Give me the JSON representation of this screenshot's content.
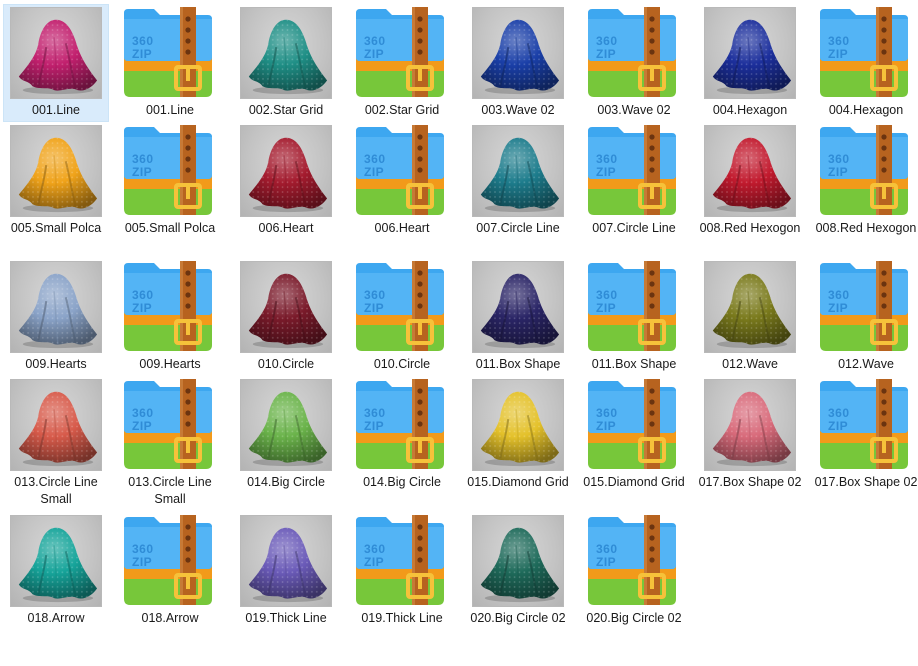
{
  "files": [
    {
      "label": "001.Line",
      "kind": "image",
      "color": "#c2206e",
      "selected": true
    },
    {
      "label": "001.Line",
      "kind": "zip",
      "icon": "360zip-archive-icon"
    },
    {
      "label": "002.Star Grid",
      "kind": "image",
      "color": "#1f8f86"
    },
    {
      "label": "002.Star Grid",
      "kind": "zip",
      "icon": "360zip-archive-icon"
    },
    {
      "label": "003.Wave 02",
      "kind": "image",
      "color": "#1a3fa8"
    },
    {
      "label": "003.Wave 02",
      "kind": "zip",
      "icon": "360zip-archive-icon"
    },
    {
      "label": "004.Hexagon",
      "kind": "image",
      "color": "#1c2f9c"
    },
    {
      "label": "004.Hexagon",
      "kind": "zip",
      "icon": "360zip-archive-icon"
    },
    {
      "label": "005.Small Polca",
      "kind": "image",
      "color": "#f0a31a"
    },
    {
      "label": "005.Small Polca",
      "kind": "zip",
      "icon": "360zip-archive-icon"
    },
    {
      "label": "006.Heart",
      "kind": "image",
      "color": "#a41b2e"
    },
    {
      "label": "006.Heart",
      "kind": "zip",
      "icon": "360zip-archive-icon"
    },
    {
      "label": "007.Circle Line",
      "kind": "image",
      "color": "#1d7c8c"
    },
    {
      "label": "007.Circle Line",
      "kind": "zip",
      "icon": "360zip-archive-icon"
    },
    {
      "label": "008.Red Hexogon",
      "kind": "image",
      "color": "#c21a2e"
    },
    {
      "label": "008.Red Hexogon",
      "kind": "zip",
      "icon": "360zip-archive-icon"
    },
    {
      "label": "009.Hearts",
      "kind": "image",
      "color": "#8aa3c8"
    },
    {
      "label": "009.Hearts",
      "kind": "zip",
      "icon": "360zip-archive-icon"
    },
    {
      "label": "010.Circle",
      "kind": "image",
      "color": "#7a1a2a"
    },
    {
      "label": "010.Circle",
      "kind": "zip",
      "icon": "360zip-archive-icon"
    },
    {
      "label": "011.Box Shape",
      "kind": "image",
      "color": "#2a2566"
    },
    {
      "label": "011.Box Shape",
      "kind": "zip",
      "icon": "360zip-archive-icon"
    },
    {
      "label": "012.Wave",
      "kind": "image",
      "color": "#7a7a1c"
    },
    {
      "label": "012.Wave",
      "kind": "zip",
      "icon": "360zip-archive-icon"
    },
    {
      "label": "013.Circle Line Small",
      "kind": "image",
      "color": "#d75a4a"
    },
    {
      "label": "013.Circle Line Small",
      "kind": "zip",
      "icon": "360zip-archive-icon"
    },
    {
      "label": "014.Big Circle",
      "kind": "image",
      "color": "#6ab34a"
    },
    {
      "label": "014.Big Circle",
      "kind": "zip",
      "icon": "360zip-archive-icon"
    },
    {
      "label": "015.Diamond Grid",
      "kind": "image",
      "color": "#e4c12a"
    },
    {
      "label": "015.Diamond Grid",
      "kind": "zip",
      "icon": "360zip-archive-icon"
    },
    {
      "label": "017.Box Shape 02",
      "kind": "image",
      "color": "#d86a7a"
    },
    {
      "label": "017.Box Shape 02",
      "kind": "zip",
      "icon": "360zip-archive-icon"
    },
    {
      "label": "018.Arrow",
      "kind": "image",
      "color": "#16a49a"
    },
    {
      "label": "018.Arrow",
      "kind": "zip",
      "icon": "360zip-archive-icon"
    },
    {
      "label": "019.Thick Line",
      "kind": "image",
      "color": "#6a5ab8"
    },
    {
      "label": "019.Thick Line",
      "kind": "zip",
      "icon": "360zip-archive-icon"
    },
    {
      "label": "020.Big Circle 02",
      "kind": "image",
      "color": "#1e6a5a"
    },
    {
      "label": "020.Big Circle 02",
      "kind": "zip",
      "icon": "360zip-archive-icon"
    }
  ],
  "zip_icon_text": {
    "brand": "360",
    "kind": "ZIP"
  }
}
